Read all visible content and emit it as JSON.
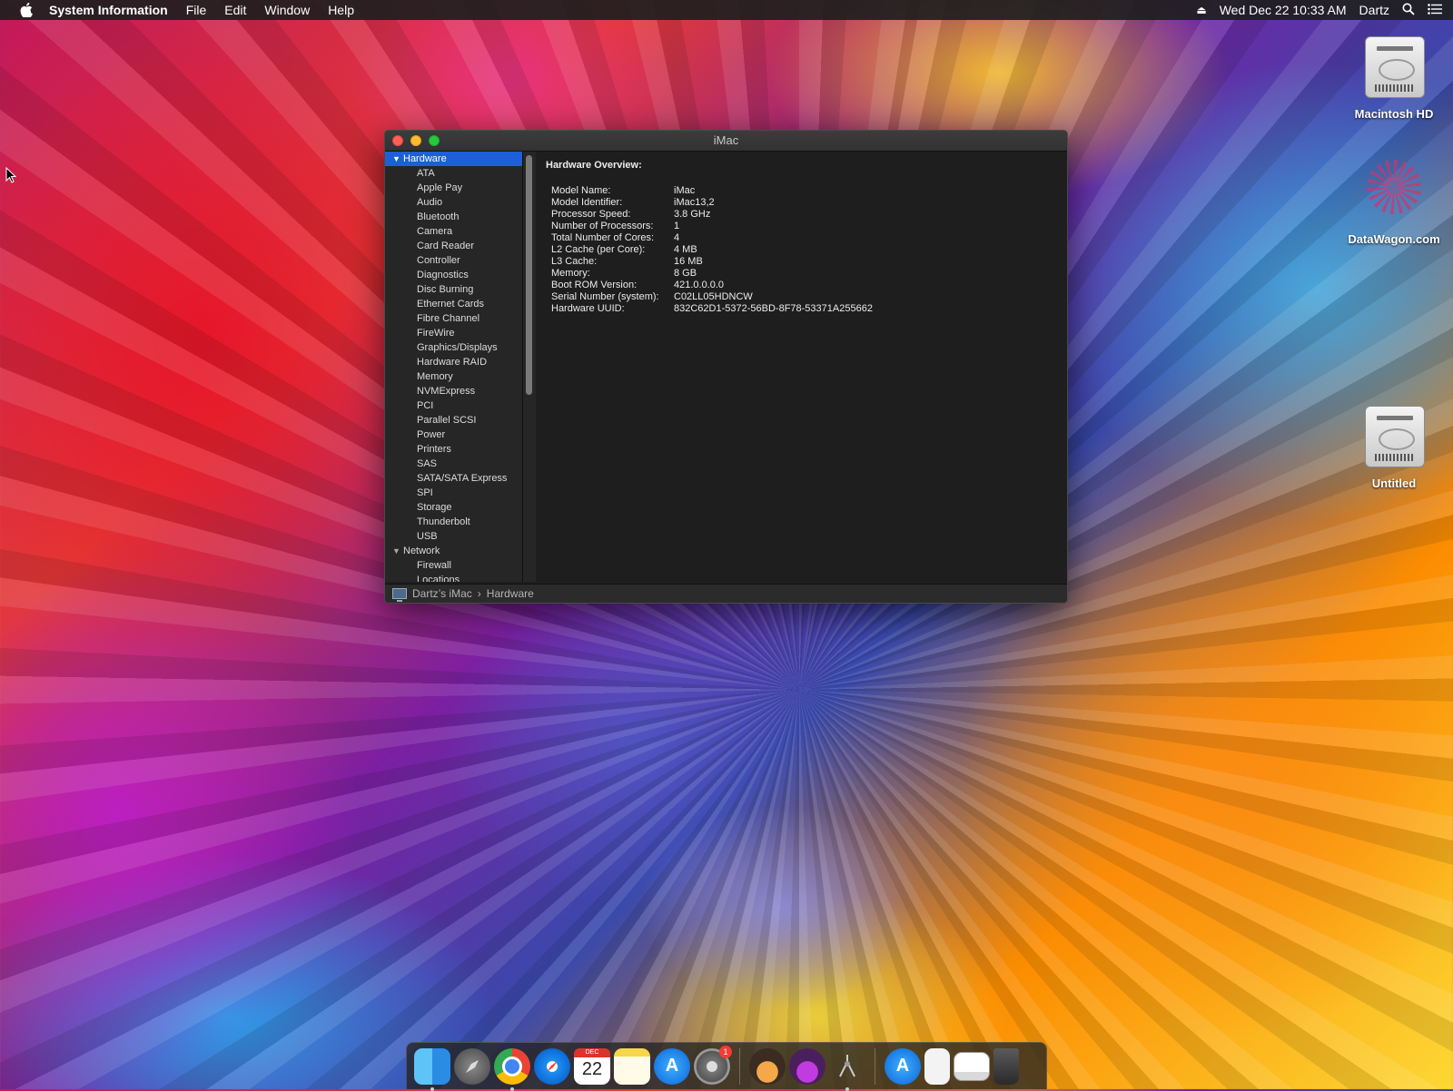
{
  "menubar": {
    "app_name": "System Information",
    "menus": [
      "File",
      "Edit",
      "Window",
      "Help"
    ],
    "clock": "Wed Dec 22  10:33 AM",
    "user": "Dartz"
  },
  "desktop_icons": {
    "hd": "Macintosh HD",
    "datawagon": "DataWagon.com",
    "untitled": "Untitled"
  },
  "window": {
    "title": "iMac",
    "sidebar": {
      "hardware_label": "Hardware",
      "hardware_items": [
        "ATA",
        "Apple Pay",
        "Audio",
        "Bluetooth",
        "Camera",
        "Card Reader",
        "Controller",
        "Diagnostics",
        "Disc Burning",
        "Ethernet Cards",
        "Fibre Channel",
        "FireWire",
        "Graphics/Displays",
        "Hardware RAID",
        "Memory",
        "NVMExpress",
        "PCI",
        "Parallel SCSI",
        "Power",
        "Printers",
        "SAS",
        "SATA/SATA Express",
        "SPI",
        "Storage",
        "Thunderbolt",
        "USB"
      ],
      "network_label": "Network",
      "network_items": [
        "Firewall",
        "Locations"
      ]
    },
    "content": {
      "heading": "Hardware Overview:",
      "rows": [
        {
          "k": "Model Name:",
          "v": "iMac"
        },
        {
          "k": "Model Identifier:",
          "v": "iMac13,2"
        },
        {
          "k": "Processor Speed:",
          "v": "3.8 GHz"
        },
        {
          "k": "Number of Processors:",
          "v": "1"
        },
        {
          "k": "Total Number of Cores:",
          "v": "4"
        },
        {
          "k": "L2 Cache (per Core):",
          "v": "4 MB"
        },
        {
          "k": "L3 Cache:",
          "v": "16 MB"
        },
        {
          "k": "Memory:",
          "v": "8 GB"
        },
        {
          "k": "Boot ROM Version:",
          "v": "421.0.0.0.0"
        },
        {
          "k": "Serial Number (system):",
          "v": "C02LL05HDNCW"
        },
        {
          "k": "Hardware UUID:",
          "v": "832C62D1-5372-56BD-8F78-53371A255662"
        }
      ]
    },
    "statusbar": {
      "computer": "Dartz’s iMac",
      "separator": "›",
      "section": "Hardware"
    }
  },
  "dock": {
    "calendar_month": "DEC",
    "calendar_day": "22",
    "prefs_badge": "1",
    "appstore_glyph": "A"
  },
  "colors": {
    "selection": "#1e5fd9",
    "window_bg": "#1e1e1e"
  }
}
